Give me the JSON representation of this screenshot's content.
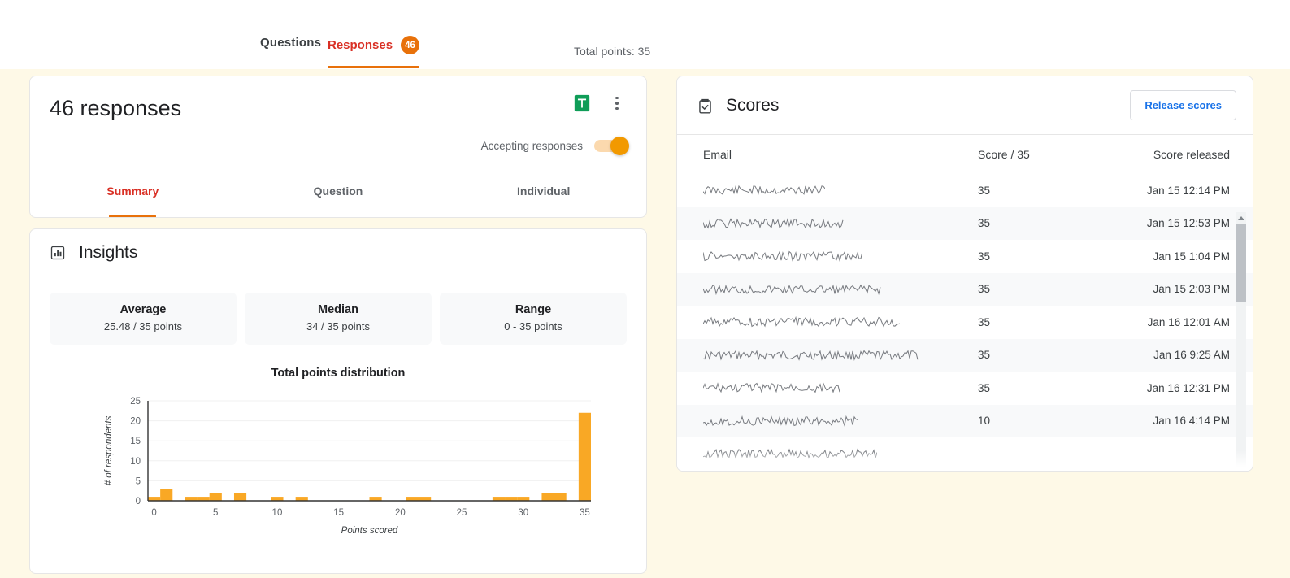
{
  "topbar": {
    "tabs": [
      {
        "label": "Questions",
        "active": false
      },
      {
        "label": "Responses",
        "active": true,
        "badge": "46"
      }
    ],
    "total_points": "Total points: 35"
  },
  "responses_card": {
    "title": "46 responses",
    "sheets_icon": "google-sheets-icon",
    "more_icon": "more-vert-icon",
    "accepting_label": "Accepting responses",
    "accepting_on": true,
    "subtabs": [
      {
        "label": "Summary",
        "active": true
      },
      {
        "label": "Question",
        "active": false
      },
      {
        "label": "Individual",
        "active": false
      }
    ]
  },
  "insights": {
    "icon": "bar-chart-icon",
    "title": "Insights",
    "stats": [
      {
        "label": "Average",
        "value": "25.48 / 35 points"
      },
      {
        "label": "Median",
        "value": "34 / 35 points"
      },
      {
        "label": "Range",
        "value": "0 - 35 points"
      }
    ]
  },
  "chart_data": {
    "type": "bar",
    "title": "Total points distribution",
    "xlabel": "Points scored",
    "ylabel": "# of respondents",
    "xlim": [
      -0.5,
      35.5
    ],
    "ylim": [
      0,
      25
    ],
    "yticks": [
      0,
      5,
      10,
      15,
      20,
      25
    ],
    "xticks": [
      0,
      5,
      10,
      15,
      20,
      25,
      30,
      35
    ],
    "grid": true,
    "bar_color": "#f9a825",
    "legend": null,
    "categories": [
      0,
      1,
      2,
      3,
      4,
      5,
      6,
      7,
      8,
      9,
      10,
      11,
      12,
      13,
      14,
      15,
      16,
      17,
      18,
      19,
      20,
      21,
      22,
      23,
      24,
      25,
      26,
      27,
      28,
      29,
      30,
      31,
      32,
      33,
      34,
      35
    ],
    "values": [
      1,
      3,
      0,
      1,
      1,
      2,
      0,
      2,
      0,
      0,
      1,
      0,
      1,
      0,
      0,
      0,
      0,
      0,
      1,
      0,
      0,
      1,
      1,
      0,
      0,
      0,
      0,
      0,
      1,
      1,
      1,
      0,
      2,
      2,
      0,
      22
    ]
  },
  "scores": {
    "icon": "clipboard-check-icon",
    "title": "Scores",
    "release_button": "Release scores",
    "columns": [
      "Email",
      "Score / 35",
      "Score released"
    ],
    "rows": [
      {
        "email": "",
        "score": "35",
        "released": "Jan 15 12:14 PM"
      },
      {
        "email": "",
        "score": "35",
        "released": "Jan 15 12:53 PM"
      },
      {
        "email": "",
        "score": "35",
        "released": "Jan 15 1:04 PM"
      },
      {
        "email": "",
        "score": "35",
        "released": "Jan 15 2:03 PM"
      },
      {
        "email": "",
        "score": "35",
        "released": "Jan 16 12:01 AM"
      },
      {
        "email": "",
        "score": "35",
        "released": "Jan 16 9:25 AM"
      },
      {
        "email": "",
        "score": "35",
        "released": "Jan 16 12:31 PM"
      },
      {
        "email": "",
        "score": "10",
        "released": "Jan 16 4:14 PM"
      },
      {
        "email": "",
        "score": "",
        "released": ""
      }
    ],
    "scrollbar": {
      "up_icon": "caret-up-icon",
      "down_icon": "caret-down-icon"
    }
  },
  "colors": {
    "accent_orange": "#e8710a",
    "red": "#d93025",
    "blue": "#1a73e8",
    "bar": "#f9a825",
    "page_bg": "#fef9e7"
  }
}
